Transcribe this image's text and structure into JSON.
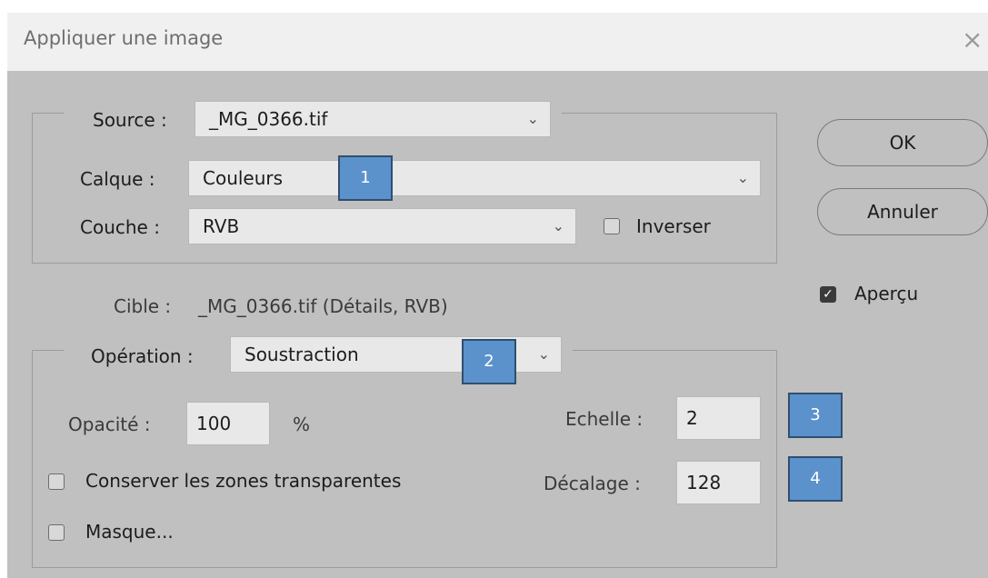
{
  "window": {
    "title": "Appliquer une image",
    "close_glyph": "×"
  },
  "source": {
    "label": "Source :",
    "value": "_MG_0366.tif",
    "calque_label": "Calque :",
    "calque_value": "Couleurs",
    "couche_label": "Couche :",
    "couche_value": "RVB",
    "inverser_label": "Inverser",
    "inverser_checked": false
  },
  "target": {
    "label": "Cible :",
    "value": "_MG_0366.tif (Détails, RVB)"
  },
  "operation": {
    "label": "Opération :",
    "value": "Soustraction",
    "opacite_label": "Opacité :",
    "opacite_value": "100",
    "opacite_unit": "%",
    "echelle_label": "Echelle :",
    "echelle_value": "2",
    "decalage_label": "Décalage :",
    "decalage_value": "128",
    "conserver_label": "Conserver les zones transparentes",
    "conserver_checked": false,
    "masque_label": "Masque...",
    "masque_checked": false
  },
  "buttons": {
    "ok": "OK",
    "cancel": "Annuler"
  },
  "apercu": {
    "label": "Aperçu",
    "checked": true
  },
  "annotations": {
    "b1": "1",
    "b2": "2",
    "b3": "3",
    "b4": "4"
  },
  "colors": {
    "dialog_bg": "#c0c0c0",
    "titlebar_bg": "#f0f0f0",
    "badge": "#5b92cc"
  }
}
